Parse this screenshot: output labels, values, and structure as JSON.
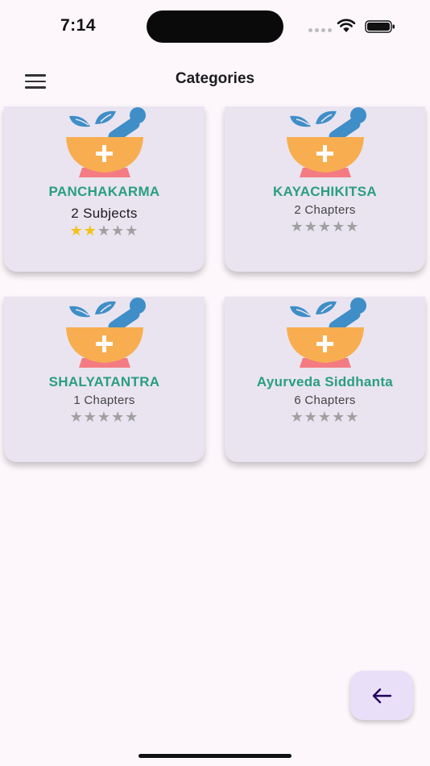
{
  "status": {
    "time": "7:14"
  },
  "app_bar": {
    "title": "Categories",
    "menu_icon": "hamburger-menu-icon"
  },
  "categories": [
    {
      "name": "PANCHAKARMA",
      "count": "2 Subjects",
      "rating": 2,
      "max_rating": 5,
      "icon": "mortar-pestle-icon"
    },
    {
      "name": "KAYACHIKITSA",
      "count": "2 Chapters",
      "rating": 0,
      "max_rating": 5,
      "icon": "mortar-pestle-icon"
    },
    {
      "name": "SHALYATANTRA",
      "count": "1 Chapters",
      "rating": 0,
      "max_rating": 5,
      "icon": "mortar-pestle-icon"
    },
    {
      "name": "Ayurveda Siddhanta",
      "count": "6 Chapters",
      "rating": 0,
      "max_rating": 5,
      "icon": "mortar-pestle-icon"
    }
  ],
  "fab": {
    "icon": "arrow-left-icon"
  },
  "colors": {
    "accent_text": "#2a9d83",
    "card_bg": "#e9e4f0",
    "star_on": "#f3c215",
    "star_off": "#a0a0a0",
    "fab_bg": "#eadff9",
    "bowl": "#f8ae50",
    "pestle": "#3f8ec7",
    "base": "#f47b82"
  }
}
